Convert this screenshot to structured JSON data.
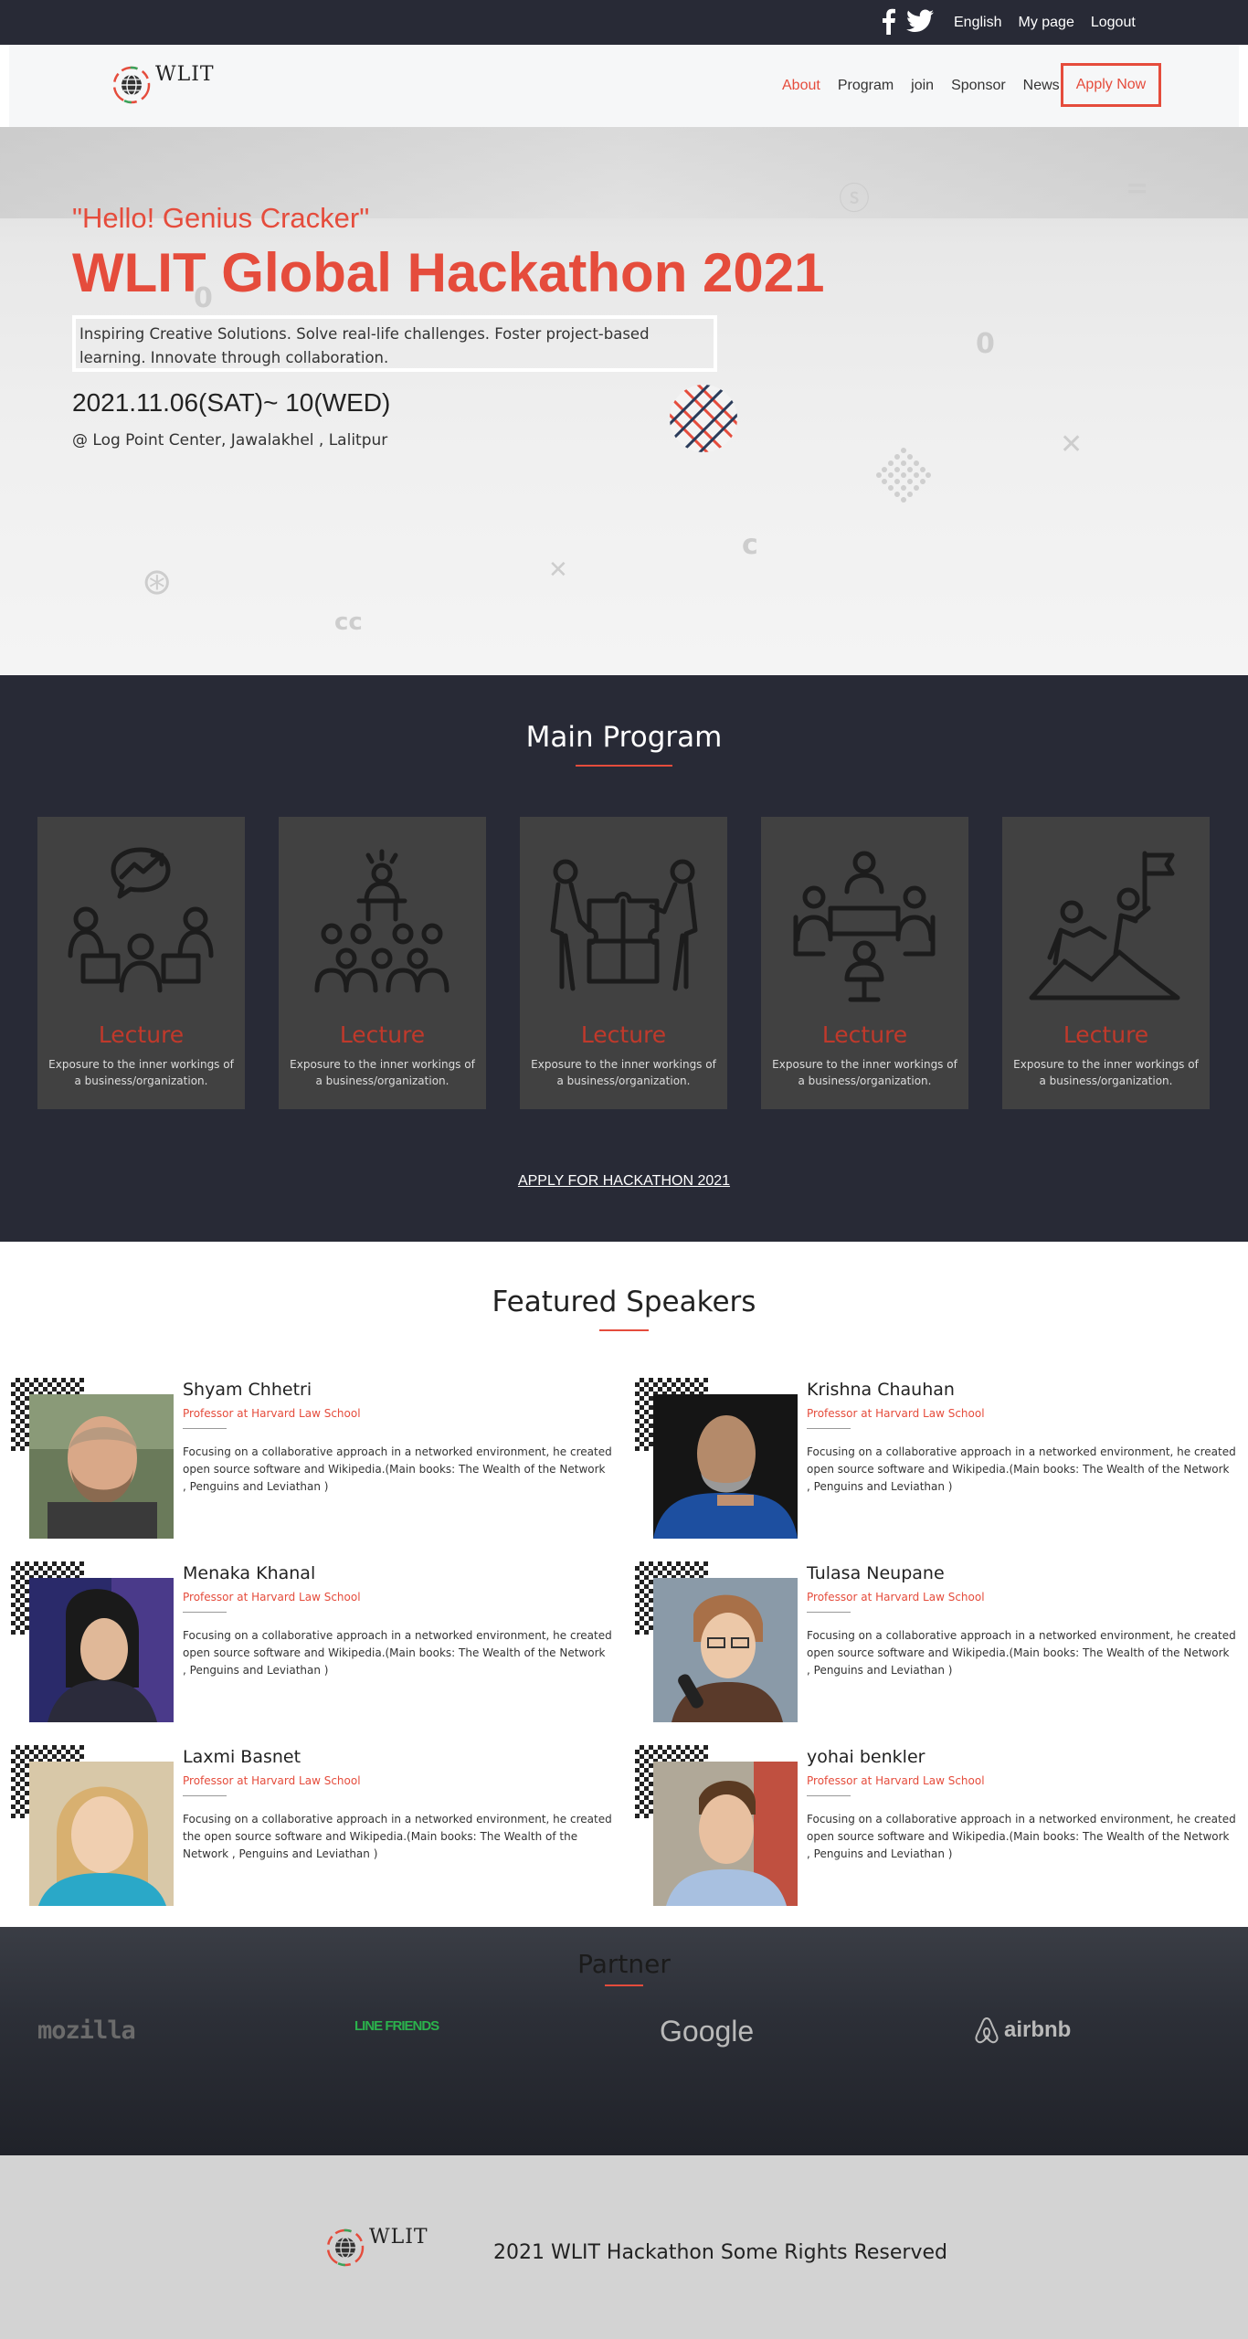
{
  "topbar": {
    "links": [
      "English",
      "My page",
      "Logout"
    ]
  },
  "nav": {
    "logo_text": "WLIT",
    "items": [
      "About",
      "Program",
      "join",
      "Sponsor",
      "News"
    ],
    "apply_label": "Apply Now"
  },
  "hero": {
    "tagline": "\"Hello! Genius Cracker\"",
    "title": "WLIT Global Hackathon 2021",
    "description": "Inspiring Creative Solutions. Solve real-life challenges. Foster project-based learning. Innovate through collaboration.",
    "date": "2021.11.06(SAT)~ 10(WED)",
    "place": "@ Log Point Center, Jawalakhel , Lalitpur"
  },
  "program": {
    "title": "Main Program",
    "cards": [
      {
        "icon": "meeting-growth-icon",
        "title": "Lecture",
        "desc": "Exposure to the inner workings of a business/organization."
      },
      {
        "icon": "audience-speaker-icon",
        "title": "Lecture",
        "desc": "Exposure to the inner workings of a business/organization."
      },
      {
        "icon": "puzzle-teamwork-icon",
        "title": "Lecture",
        "desc": "Exposure to the inner workings of a business/organization."
      },
      {
        "icon": "round-table-icon",
        "title": "Lecture",
        "desc": "Exposure to the inner workings of a business/organization."
      },
      {
        "icon": "summit-flag-icon",
        "title": "Lecture",
        "desc": "Exposure to the inner workings of a business/organization."
      }
    ],
    "apply_link": "APPLY FOR HACKATHON 2021"
  },
  "speakers": {
    "title": "Featured Speakers",
    "items": [
      {
        "name": "Shyam Chhetri",
        "role": "Professor at Harvard Law School",
        "bio": "Focusing on a collaborative approach in a networked environment, he created open source software and Wikipedia.(Main books: The Wealth of the Network , Penguins and Leviathan )"
      },
      {
        "name": "Krishna Chauhan",
        "role": "Professor at Harvard Law School",
        "bio": "Focusing on a collaborative approach in a networked environment, he created open source software and Wikipedia.(Main books: The Wealth of the Network , Penguins and Leviathan )"
      },
      {
        "name": "Menaka Khanal",
        "role": "Professor at Harvard Law School",
        "bio": "Focusing on a collaborative approach in a networked environment, he created open source software and Wikipedia.(Main books: The Wealth of the Network , Penguins and Leviathan )"
      },
      {
        "name": "Tulasa Neupane",
        "role": "Professor at Harvard Law School",
        "bio": "Focusing on a collaborative approach in a networked environment, he created open source software and Wikipedia.(Main books: The Wealth of the Network , Penguins and Leviathan )"
      },
      {
        "name": "Laxmi Basnet",
        "role": "Professor at Harvard Law School",
        "bio": "Focusing on a collaborative approach in a networked environment, he created the open source software and Wikipedia.(Main books: The Wealth of the Network , Penguins and Leviathan )"
      },
      {
        "name": "yohai benkler",
        "role": "Professor at Harvard Law School",
        "bio": "Focusing on a collaborative approach in a networked environment, he created open source software and Wikipedia.(Main books: The Wealth of the Network , Penguins and Leviathan )"
      }
    ]
  },
  "partner": {
    "title": "Partner",
    "logos": [
      "mozilla",
      "LINE FRIENDS",
      "Google",
      "airbnb"
    ]
  },
  "footer": {
    "logo_text": "WLIT",
    "copyright": "2021 WLIT Hackathon Some Rights Reserved"
  },
  "colors": {
    "accent": "#e54c3c",
    "dark": "#282a36",
    "card": "#414141",
    "footer": "#d3d3d3"
  }
}
